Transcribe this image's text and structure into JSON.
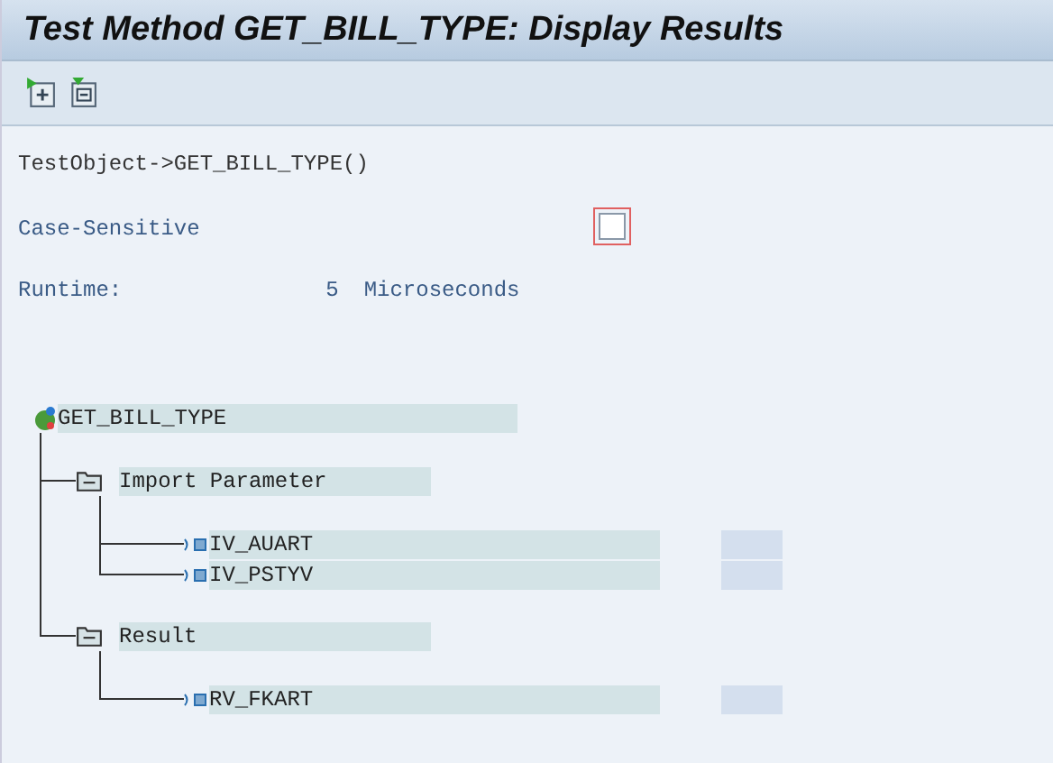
{
  "window": {
    "title": "Test Method GET_BILL_TYPE: Display Results"
  },
  "call": "TestObject->GET_BILL_TYPE()",
  "case_sensitive": {
    "label": "Case-Sensitive",
    "checked": false
  },
  "runtime": {
    "label": "Runtime:",
    "value": "5",
    "unit": "Microseconds"
  },
  "tree": {
    "label": "GET_BILL_TYPE",
    "children": [
      {
        "label": "Import Parameter",
        "expanded": true,
        "children": [
          {
            "label": "IV_AUART"
          },
          {
            "label": "IV_PSTYV"
          }
        ]
      },
      {
        "label": "Result",
        "expanded": true,
        "children": [
          {
            "label": "RV_FKART"
          }
        ]
      }
    ]
  }
}
